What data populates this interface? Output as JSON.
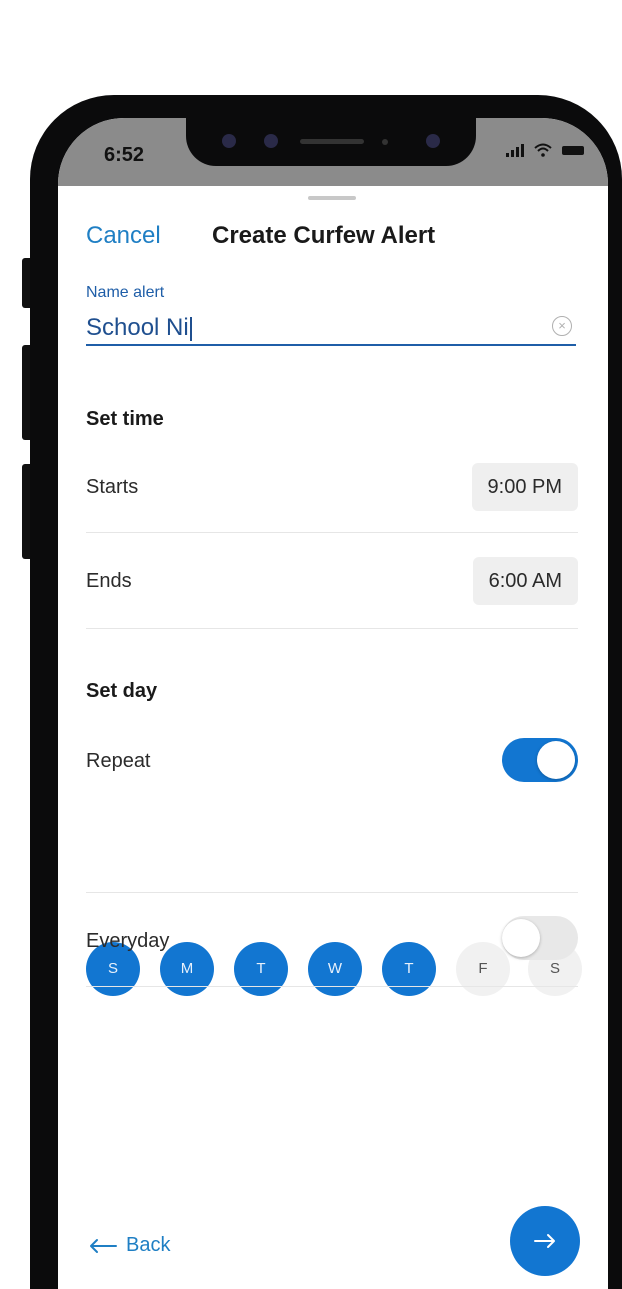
{
  "status_bar": {
    "time": "6:52"
  },
  "header": {
    "cancel_label": "Cancel",
    "title": "Create Curfew Alert"
  },
  "name_field": {
    "label": "Name alert",
    "value": "School Ni"
  },
  "set_time": {
    "title": "Set time",
    "starts_label": "Starts",
    "starts_value": "9:00 PM",
    "ends_label": "Ends",
    "ends_value": "6:00 AM"
  },
  "set_day": {
    "title": "Set day",
    "repeat_label": "Repeat",
    "repeat_on": true,
    "days": [
      {
        "label": "S",
        "selected": true
      },
      {
        "label": "M",
        "selected": true
      },
      {
        "label": "T",
        "selected": true
      },
      {
        "label": "W",
        "selected": true
      },
      {
        "label": "T",
        "selected": true
      },
      {
        "label": "F",
        "selected": false
      },
      {
        "label": "S",
        "selected": false
      }
    ],
    "everyday_label": "Everyday",
    "everyday_on": false
  },
  "footer": {
    "back_label": "Back"
  },
  "icons": {
    "clear": "clear-circle-icon",
    "back": "arrow-left-icon",
    "next": "arrow-right-icon",
    "signal": "cellular-signal-icon",
    "wifi": "wifi-icon",
    "battery": "battery-icon"
  },
  "colors": {
    "accent": "#1276d1",
    "link": "#1f7fc4",
    "input_text": "#1f4f8f",
    "statusbar": "#8b8b8b",
    "toggle_off": "#e8e8e8",
    "day_off": "#f1f1f1"
  }
}
